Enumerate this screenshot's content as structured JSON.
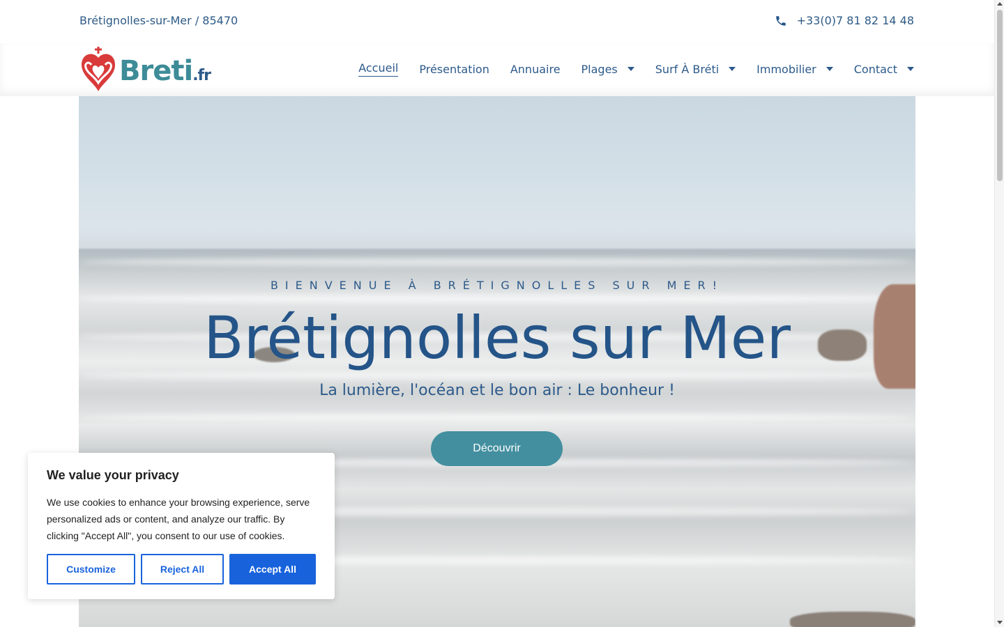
{
  "topbar": {
    "location": "Brétignolles-sur-Mer / 85470",
    "phone_icon": "phone-icon",
    "phone": "+33(0)7 81 82 14 48"
  },
  "logo": {
    "name": "Breti",
    "tld": ".fr",
    "icon": "vendee-heart-logo"
  },
  "nav": {
    "items": [
      {
        "label": "Accueil",
        "active": true,
        "dropdown": false
      },
      {
        "label": "Présentation",
        "active": false,
        "dropdown": false
      },
      {
        "label": "Annuaire",
        "active": false,
        "dropdown": false
      },
      {
        "label": "Plages",
        "active": false,
        "dropdown": true
      },
      {
        "label": "Surf À Bréti",
        "active": false,
        "dropdown": true
      },
      {
        "label": "Immobilier",
        "active": false,
        "dropdown": true
      },
      {
        "label": "Contact",
        "active": false,
        "dropdown": true
      }
    ]
  },
  "hero": {
    "kicker": "BIENVENUE À BRÉTIGNOLLES SUR MER!",
    "title": "Brétignolles sur Mer",
    "subtitle": "La lumière, l'océan et le bon air : Le bonheur !",
    "cta": "Découvrir"
  },
  "cookie": {
    "title": "We value your privacy",
    "text": "We use cookies to enhance your browsing experience, serve personalized ads or content, and analyze our traffic. By clicking \"Accept All\", you consent to our use of cookies.",
    "customize": "Customize",
    "reject": "Reject All",
    "accept": "Accept All"
  },
  "colors": {
    "brand_teal": "#438f9f",
    "brand_blue": "#2d5a8a",
    "logo_red": "#d93a3a",
    "cookie_blue": "#1863dc"
  }
}
